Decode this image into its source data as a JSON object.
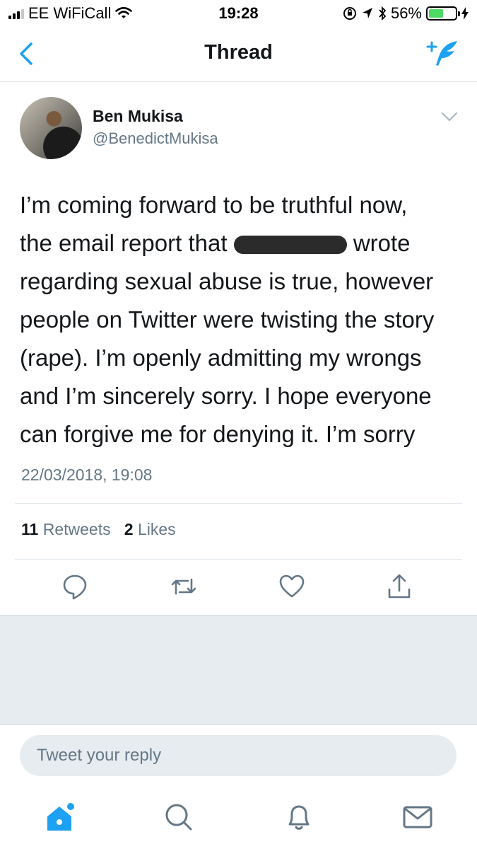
{
  "status_bar": {
    "carrier": "EE WiFiCall",
    "time": "19:28",
    "battery": "56%",
    "battery_level": 0.56,
    "icons": [
      "signal-icon",
      "wifi-icon",
      "orientation-lock-icon",
      "location-icon",
      "bluetooth-icon",
      "battery-icon",
      "charging-icon"
    ]
  },
  "nav": {
    "title": "Thread",
    "back_icon": "chevron-left-icon",
    "compose_icon": "compose-tweet-icon"
  },
  "tweet": {
    "author_name": "Ben Mukisa",
    "handle": "@BenedictMukisa",
    "lines": [
      "I’m coming forward to be truthful now,",
      "the email report that ",
      " wrote",
      "regarding sexual abuse is true, however",
      "people on Twitter were twisting the story",
      "(rape). I’m openly admitting my wrongs",
      "and I’m sincerely sorry. I hope everyone",
      "can forgive me for denying it. I’m sorry"
    ],
    "timestamp": "22/03/2018, 19:08",
    "retweets_count": "11",
    "retweets_label": "Retweets",
    "likes_count": "2",
    "likes_label": "Likes"
  },
  "actions": [
    "reply-icon",
    "retweet-icon",
    "like-icon",
    "share-icon"
  ],
  "reply": {
    "placeholder": "Tweet your reply"
  },
  "tabbar": [
    "home-icon",
    "search-icon",
    "notifications-icon",
    "messages-icon"
  ],
  "colors": {
    "accent": "#1da1f2",
    "text": "#14171a",
    "secondary_text": "#657786",
    "divider": "#e1e8ed",
    "grey_background": "#e6ecf0"
  }
}
